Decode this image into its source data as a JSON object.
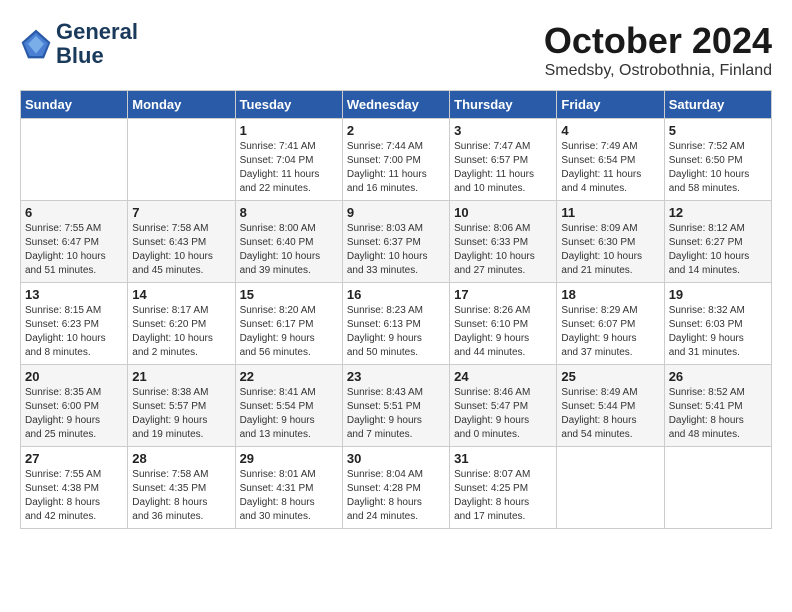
{
  "header": {
    "logo_line1": "General",
    "logo_line2": "Blue",
    "month": "October 2024",
    "location": "Smedsby, Ostrobothnia, Finland"
  },
  "days_of_week": [
    "Sunday",
    "Monday",
    "Tuesday",
    "Wednesday",
    "Thursday",
    "Friday",
    "Saturday"
  ],
  "weeks": [
    [
      {
        "day": "",
        "info": ""
      },
      {
        "day": "",
        "info": ""
      },
      {
        "day": "1",
        "info": "Sunrise: 7:41 AM\nSunset: 7:04 PM\nDaylight: 11 hours\nand 22 minutes."
      },
      {
        "day": "2",
        "info": "Sunrise: 7:44 AM\nSunset: 7:00 PM\nDaylight: 11 hours\nand 16 minutes."
      },
      {
        "day": "3",
        "info": "Sunrise: 7:47 AM\nSunset: 6:57 PM\nDaylight: 11 hours\nand 10 minutes."
      },
      {
        "day": "4",
        "info": "Sunrise: 7:49 AM\nSunset: 6:54 PM\nDaylight: 11 hours\nand 4 minutes."
      },
      {
        "day": "5",
        "info": "Sunrise: 7:52 AM\nSunset: 6:50 PM\nDaylight: 10 hours\nand 58 minutes."
      }
    ],
    [
      {
        "day": "6",
        "info": "Sunrise: 7:55 AM\nSunset: 6:47 PM\nDaylight: 10 hours\nand 51 minutes."
      },
      {
        "day": "7",
        "info": "Sunrise: 7:58 AM\nSunset: 6:43 PM\nDaylight: 10 hours\nand 45 minutes."
      },
      {
        "day": "8",
        "info": "Sunrise: 8:00 AM\nSunset: 6:40 PM\nDaylight: 10 hours\nand 39 minutes."
      },
      {
        "day": "9",
        "info": "Sunrise: 8:03 AM\nSunset: 6:37 PM\nDaylight: 10 hours\nand 33 minutes."
      },
      {
        "day": "10",
        "info": "Sunrise: 8:06 AM\nSunset: 6:33 PM\nDaylight: 10 hours\nand 27 minutes."
      },
      {
        "day": "11",
        "info": "Sunrise: 8:09 AM\nSunset: 6:30 PM\nDaylight: 10 hours\nand 21 minutes."
      },
      {
        "day": "12",
        "info": "Sunrise: 8:12 AM\nSunset: 6:27 PM\nDaylight: 10 hours\nand 14 minutes."
      }
    ],
    [
      {
        "day": "13",
        "info": "Sunrise: 8:15 AM\nSunset: 6:23 PM\nDaylight: 10 hours\nand 8 minutes."
      },
      {
        "day": "14",
        "info": "Sunrise: 8:17 AM\nSunset: 6:20 PM\nDaylight: 10 hours\nand 2 minutes."
      },
      {
        "day": "15",
        "info": "Sunrise: 8:20 AM\nSunset: 6:17 PM\nDaylight: 9 hours\nand 56 minutes."
      },
      {
        "day": "16",
        "info": "Sunrise: 8:23 AM\nSunset: 6:13 PM\nDaylight: 9 hours\nand 50 minutes."
      },
      {
        "day": "17",
        "info": "Sunrise: 8:26 AM\nSunset: 6:10 PM\nDaylight: 9 hours\nand 44 minutes."
      },
      {
        "day": "18",
        "info": "Sunrise: 8:29 AM\nSunset: 6:07 PM\nDaylight: 9 hours\nand 37 minutes."
      },
      {
        "day": "19",
        "info": "Sunrise: 8:32 AM\nSunset: 6:03 PM\nDaylight: 9 hours\nand 31 minutes."
      }
    ],
    [
      {
        "day": "20",
        "info": "Sunrise: 8:35 AM\nSunset: 6:00 PM\nDaylight: 9 hours\nand 25 minutes."
      },
      {
        "day": "21",
        "info": "Sunrise: 8:38 AM\nSunset: 5:57 PM\nDaylight: 9 hours\nand 19 minutes."
      },
      {
        "day": "22",
        "info": "Sunrise: 8:41 AM\nSunset: 5:54 PM\nDaylight: 9 hours\nand 13 minutes."
      },
      {
        "day": "23",
        "info": "Sunrise: 8:43 AM\nSunset: 5:51 PM\nDaylight: 9 hours\nand 7 minutes."
      },
      {
        "day": "24",
        "info": "Sunrise: 8:46 AM\nSunset: 5:47 PM\nDaylight: 9 hours\nand 0 minutes."
      },
      {
        "day": "25",
        "info": "Sunrise: 8:49 AM\nSunset: 5:44 PM\nDaylight: 8 hours\nand 54 minutes."
      },
      {
        "day": "26",
        "info": "Sunrise: 8:52 AM\nSunset: 5:41 PM\nDaylight: 8 hours\nand 48 minutes."
      }
    ],
    [
      {
        "day": "27",
        "info": "Sunrise: 7:55 AM\nSunset: 4:38 PM\nDaylight: 8 hours\nand 42 minutes."
      },
      {
        "day": "28",
        "info": "Sunrise: 7:58 AM\nSunset: 4:35 PM\nDaylight: 8 hours\nand 36 minutes."
      },
      {
        "day": "29",
        "info": "Sunrise: 8:01 AM\nSunset: 4:31 PM\nDaylight: 8 hours\nand 30 minutes."
      },
      {
        "day": "30",
        "info": "Sunrise: 8:04 AM\nSunset: 4:28 PM\nDaylight: 8 hours\nand 24 minutes."
      },
      {
        "day": "31",
        "info": "Sunrise: 8:07 AM\nSunset: 4:25 PM\nDaylight: 8 hours\nand 17 minutes."
      },
      {
        "day": "",
        "info": ""
      },
      {
        "day": "",
        "info": ""
      }
    ]
  ]
}
